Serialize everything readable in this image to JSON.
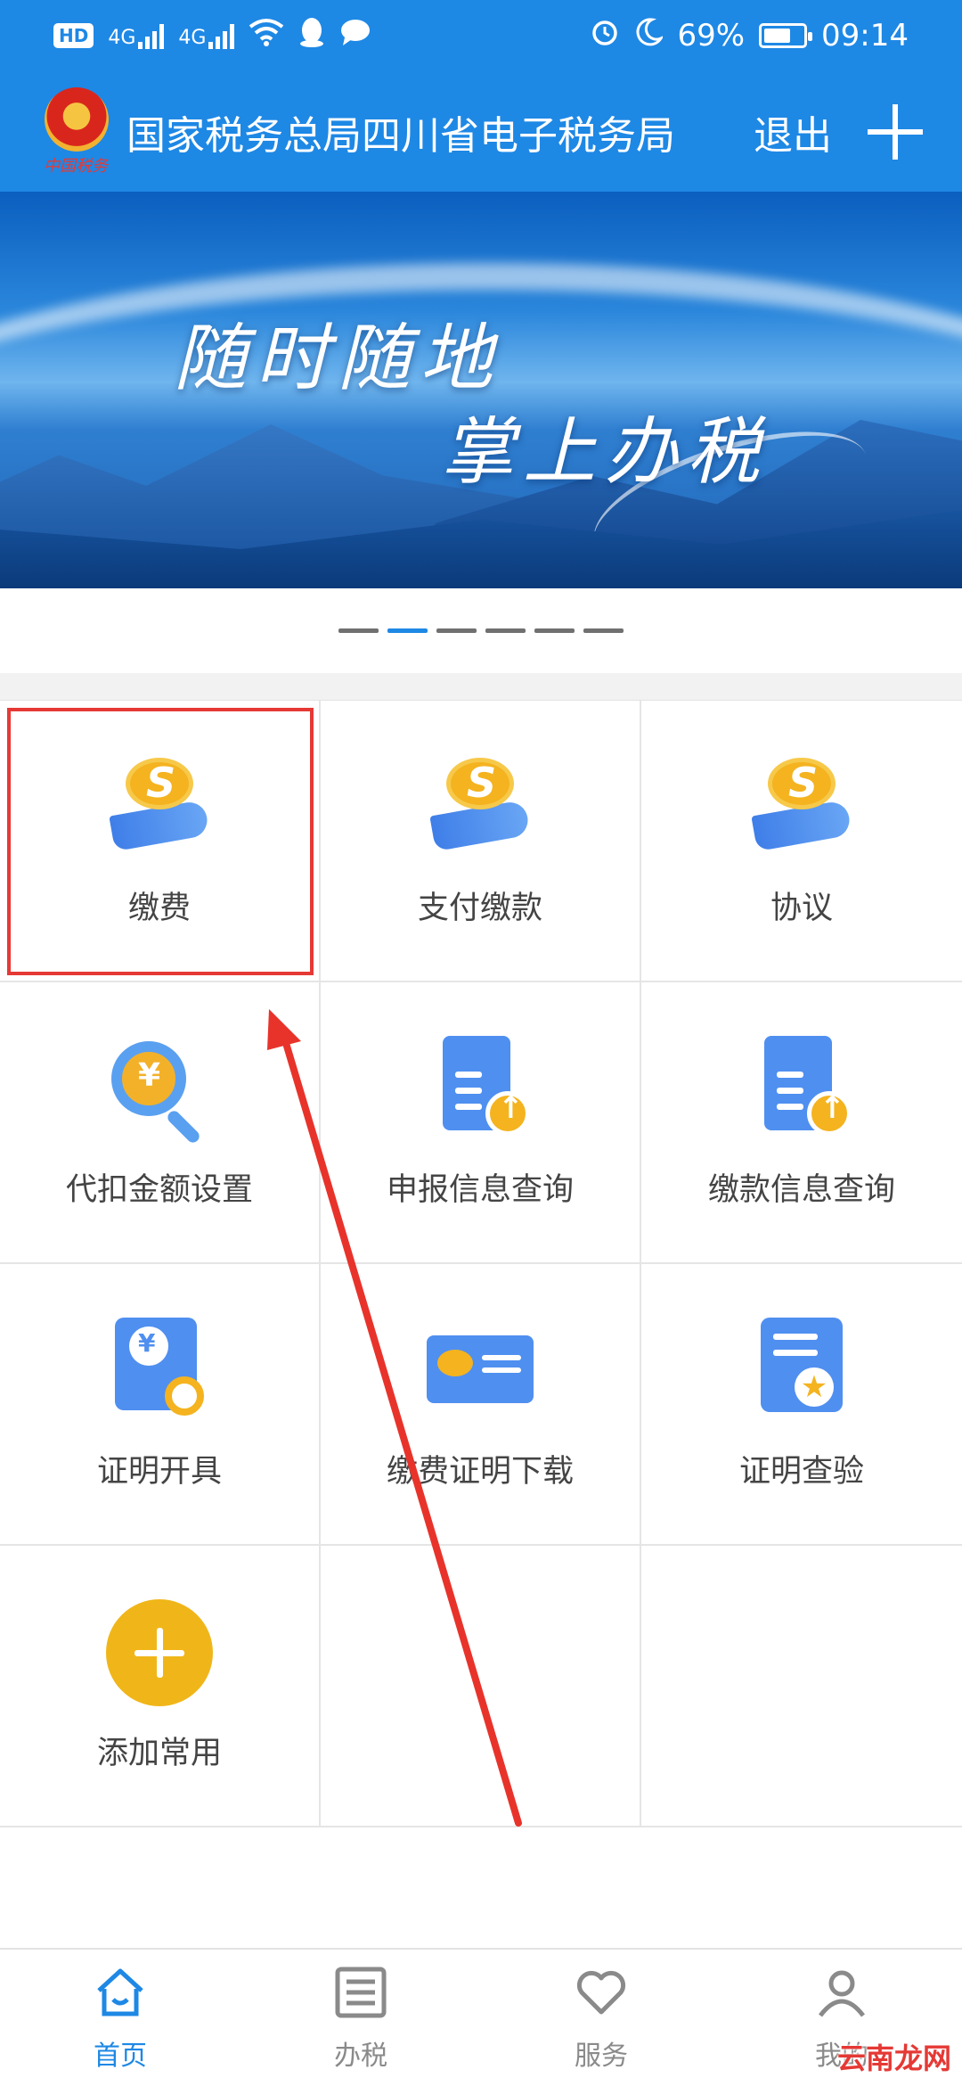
{
  "status_bar": {
    "hd_badge": "HD",
    "signal_1": "4G",
    "signal_2": "4G",
    "battery_percent": "69%",
    "battery_level": 0.69,
    "time": "09:14"
  },
  "header": {
    "emblem_script": "中国税务",
    "title": "国家税务总局四川省电子税务局",
    "logout_label": "退出"
  },
  "banner": {
    "line1": "随时随地",
    "line2": "掌上办税",
    "slide_count": 6,
    "active_slide": 1
  },
  "grid": {
    "items": [
      {
        "label": "缴费",
        "icon": "coin-hand-icon"
      },
      {
        "label": "支付缴款",
        "icon": "coin-hand-icon"
      },
      {
        "label": "协议",
        "icon": "coin-hand-icon"
      },
      {
        "label": "代扣金额设置",
        "icon": "magnifier-yen-icon"
      },
      {
        "label": "申报信息查询",
        "icon": "document-upload-icon"
      },
      {
        "label": "缴款信息查询",
        "icon": "document-upload-icon"
      },
      {
        "label": "证明开具",
        "icon": "certificate-search-icon"
      },
      {
        "label": "缴费证明下载",
        "icon": "card-icon"
      },
      {
        "label": "证明查验",
        "icon": "certificate-star-icon"
      },
      {
        "label": "添加常用",
        "icon": "add-circle-icon"
      }
    ]
  },
  "bottom_nav": {
    "tabs": [
      {
        "label": "首页",
        "icon": "home-icon"
      },
      {
        "label": "办税",
        "icon": "list-icon"
      },
      {
        "label": "服务",
        "icon": "heart-icon"
      },
      {
        "label": "我的",
        "icon": "user-icon"
      }
    ]
  },
  "watermark": "云南龙网",
  "colors": {
    "primary": "#1e88e5",
    "accent": "#f0b619",
    "highlight": "#e53935"
  }
}
